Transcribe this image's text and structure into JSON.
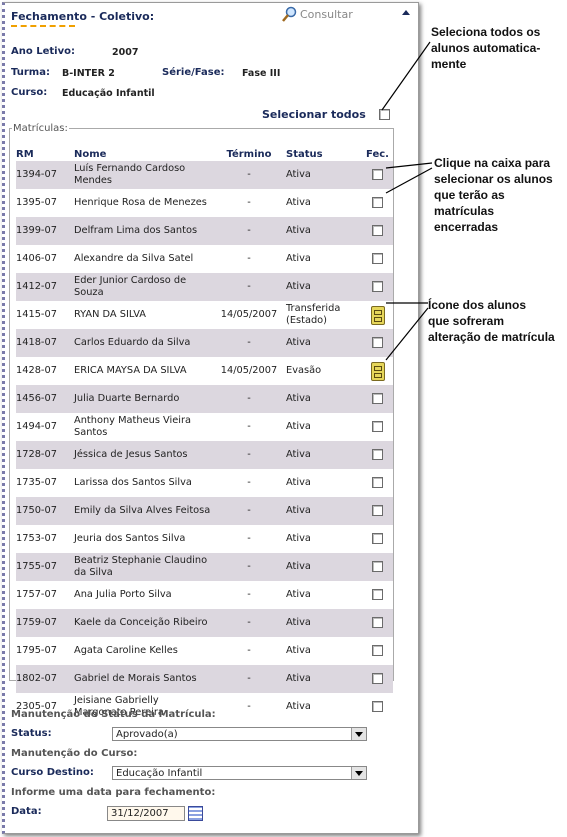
{
  "header": {
    "title": "Fechamento - Coletivo:",
    "consultar": "Consultar"
  },
  "info": {
    "ano_label": "Ano Letivo:",
    "ano_value": "2007",
    "turma_label": "Turma:",
    "turma_value": "B-INTER 2",
    "serie_label": "Série/Fase:",
    "serie_value": "Fase III",
    "curso_label": "Curso:",
    "curso_value": "Educação Infantil"
  },
  "select_all_label": "Selecionar todos",
  "matriculas": {
    "legend": "Matrículas:",
    "columns": [
      "RM",
      "Nome",
      "Término",
      "Status",
      "Fec."
    ],
    "rows": [
      {
        "rm": "1394-07",
        "nome": "Luís Fernando Cardoso Mendes",
        "termino": "-",
        "status": "Ativa",
        "fec": "checkbox"
      },
      {
        "rm": "1395-07",
        "nome": "Henrique Rosa de Menezes",
        "termino": "-",
        "status": "Ativa",
        "fec": "checkbox"
      },
      {
        "rm": "1399-07",
        "nome": "Delfram Lima dos Santos",
        "termino": "-",
        "status": "Ativa",
        "fec": "checkbox"
      },
      {
        "rm": "1406-07",
        "nome": "Alexandre da Silva Satel",
        "termino": "-",
        "status": "Ativa",
        "fec": "checkbox"
      },
      {
        "rm": "1412-07",
        "nome": "Eder Junior Cardoso de Souza",
        "termino": "-",
        "status": "Ativa",
        "fec": "checkbox"
      },
      {
        "rm": "1415-07",
        "nome": "RYAN DA SILVA",
        "termino": "14/05/2007",
        "status": "Transferida (Estado)",
        "fec": "cabinet"
      },
      {
        "rm": "1418-07",
        "nome": "Carlos Eduardo da Silva",
        "termino": "-",
        "status": "Ativa",
        "fec": "checkbox"
      },
      {
        "rm": "1428-07",
        "nome": "ERICA MAYSA DA SILVA",
        "termino": "14/05/2007",
        "status": "Evasão",
        "fec": "cabinet"
      },
      {
        "rm": "1456-07",
        "nome": "Julia Duarte Bernardo",
        "termino": "-",
        "status": "Ativa",
        "fec": "checkbox"
      },
      {
        "rm": "1494-07",
        "nome": "Anthony Matheus Vieira Santos",
        "termino": "-",
        "status": "Ativa",
        "fec": "checkbox"
      },
      {
        "rm": "1728-07",
        "nome": "Jéssica de Jesus Santos",
        "termino": "-",
        "status": "Ativa",
        "fec": "checkbox"
      },
      {
        "rm": "1735-07",
        "nome": "Larissa dos Santos Silva",
        "termino": "-",
        "status": "Ativa",
        "fec": "checkbox"
      },
      {
        "rm": "1750-07",
        "nome": "Emily da Silva Alves Feitosa",
        "termino": "-",
        "status": "Ativa",
        "fec": "checkbox"
      },
      {
        "rm": "1753-07",
        "nome": "Jeuria dos Santos Silva",
        "termino": "-",
        "status": "Ativa",
        "fec": "checkbox"
      },
      {
        "rm": "1755-07",
        "nome": "Beatriz Stephanie Claudino da Silva",
        "termino": "-",
        "status": "Ativa",
        "fec": "checkbox"
      },
      {
        "rm": "1757-07",
        "nome": "Ana Julia Porto Silva",
        "termino": "-",
        "status": "Ativa",
        "fec": "checkbox"
      },
      {
        "rm": "1759-07",
        "nome": "Kaele da Conceição Ribeiro",
        "termino": "-",
        "status": "Ativa",
        "fec": "checkbox"
      },
      {
        "rm": "1795-07",
        "nome": "Agata Caroline Kelles",
        "termino": "-",
        "status": "Ativa",
        "fec": "checkbox"
      },
      {
        "rm": "1802-07",
        "nome": "Gabriel de Morais Santos",
        "termino": "-",
        "status": "Ativa",
        "fec": "checkbox"
      },
      {
        "rm": "2305-07",
        "nome": "Jeisiane Gabrielly Margonato Pereira",
        "termino": "-",
        "status": "Ativa",
        "fec": "checkbox"
      }
    ]
  },
  "bottom": {
    "manut_status_heading": "Manutenção do Status da Matrícula:",
    "status_label": "Status:",
    "status_value": "Aprovado(a)",
    "manut_curso_heading": "Manutenção do Curso:",
    "curso_destino_label": "Curso Destino:",
    "curso_destino_value": "Educação Infantil",
    "data_heading": "Informe uma data para fechamento:",
    "data_label": "Data:",
    "data_value": "31/12/2007"
  },
  "annotations": {
    "note1": [
      "Seleciona todos os",
      "alunos automatica-",
      "mente"
    ],
    "note2": [
      "Clique na caixa para",
      "selecionar os alunos",
      "que terão as matrículas",
      "encerradas"
    ],
    "note3": [
      "Ícone dos alunos",
      "que sofreram",
      "alteração de matrícula"
    ]
  },
  "colors": {
    "heading": "#1a2a5a",
    "row_shade": "#dcd7df",
    "accent_underline": "#f0a000",
    "cabinet": "#e6d65a"
  }
}
